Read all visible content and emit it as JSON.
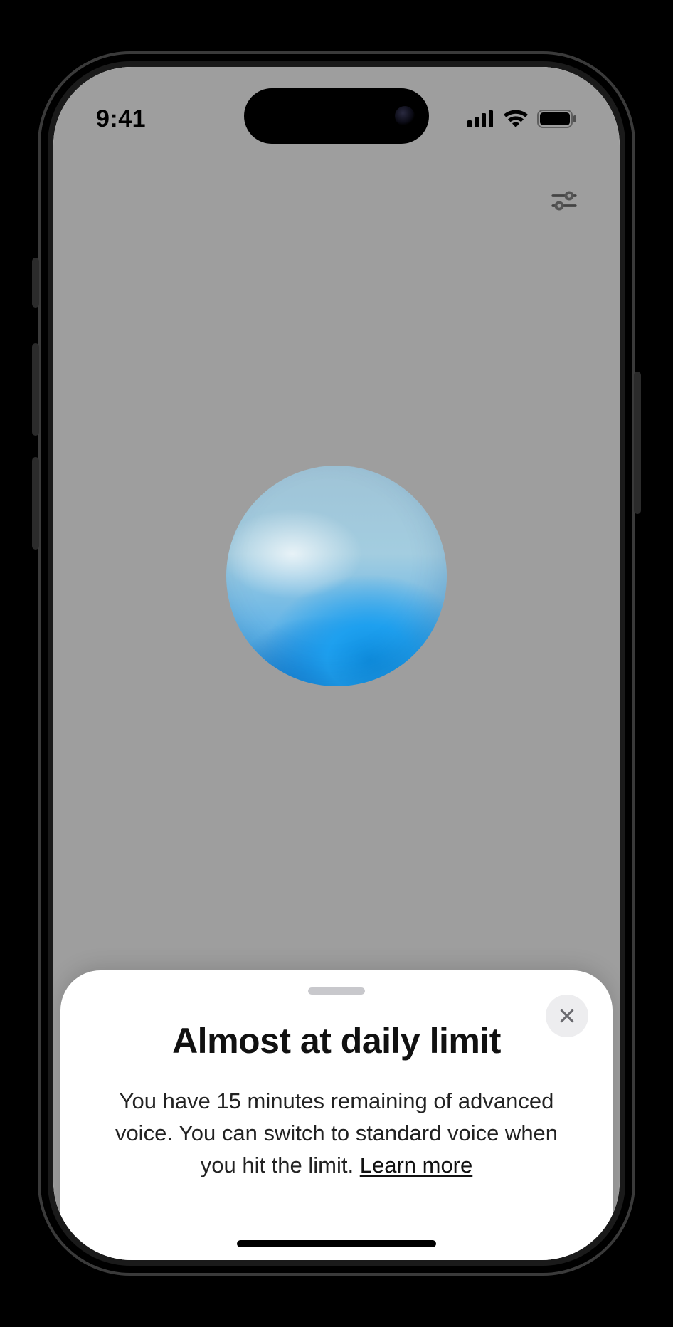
{
  "statusbar": {
    "time": "9:41"
  },
  "icons": {
    "settings": "sliders-icon",
    "close": "close-icon",
    "signal": "cellular-signal-icon",
    "wifi": "wifi-icon",
    "battery": "battery-icon"
  },
  "sheet": {
    "title": "Almost at daily limit",
    "body_prefix": "You have 15 minutes remaining of advanced voice. You can switch to standard voice when you hit the limit. ",
    "learn_more": "Learn more"
  }
}
